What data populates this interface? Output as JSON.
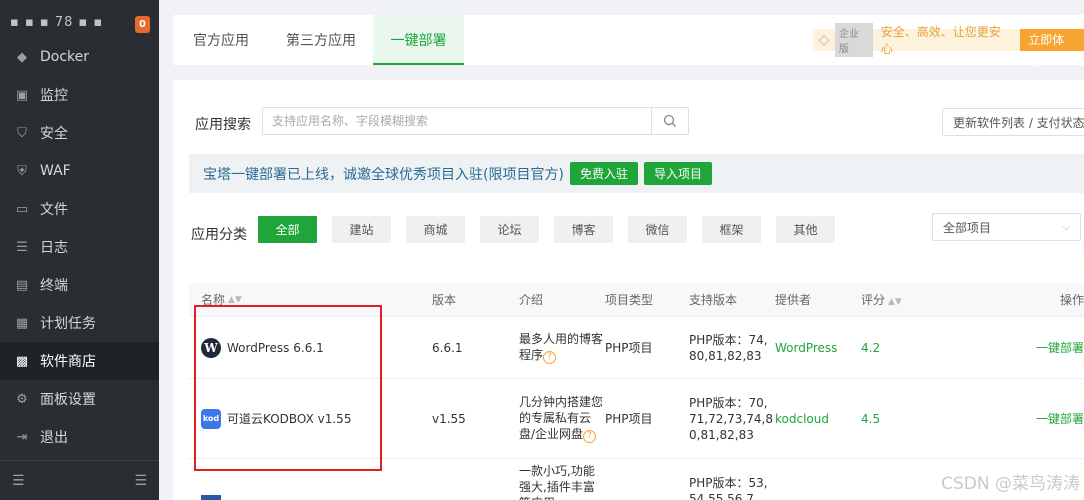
{
  "sidebar": {
    "host": "▪ ▪ ▪ 78 ▪ ▪",
    "badge": "0",
    "items": [
      {
        "label": "Docker",
        "icon": "docker-icon",
        "glyph": "◆"
      },
      {
        "label": "监控",
        "icon": "monitor-icon",
        "glyph": "▣"
      },
      {
        "label": "安全",
        "icon": "shield-icon",
        "glyph": "⛉"
      },
      {
        "label": "WAF",
        "icon": "waf-icon",
        "glyph": "⛨"
      },
      {
        "label": "文件",
        "icon": "folder-icon",
        "glyph": "▭"
      },
      {
        "label": "日志",
        "icon": "log-icon",
        "glyph": "☰"
      },
      {
        "label": "终端",
        "icon": "terminal-icon",
        "glyph": "▤"
      },
      {
        "label": "计划任务",
        "icon": "calendar-icon",
        "glyph": "▦"
      },
      {
        "label": "软件商店",
        "icon": "store-icon",
        "glyph": "▩"
      },
      {
        "label": "面板设置",
        "icon": "gear-icon",
        "glyph": "⚙"
      },
      {
        "label": "退出",
        "icon": "logout-icon",
        "glyph": "⇥"
      }
    ],
    "bottom_left": "☰",
    "bottom_right": "☰"
  },
  "tabs": [
    "官方应用",
    "第三方应用",
    "一键部署"
  ],
  "enterprise": {
    "tag": "企业版",
    "slogan": "安全、高效、让您更安心",
    "trial": "立即体验"
  },
  "search": {
    "label": "应用搜索",
    "placeholder": "支持应用名称、字段模糊搜索"
  },
  "update_button": "更新软件列表 / 支付状态",
  "notice": {
    "text": "宝塔一键部署已上线，诚邀全球优秀项目入驻(限项目官方)",
    "join": "免费入驻",
    "import": "导入项目"
  },
  "categories": {
    "label": "应用分类",
    "items": [
      "全部",
      "建站",
      "商城",
      "论坛",
      "博客",
      "微信",
      "框架",
      "其他"
    ]
  },
  "filter_select": "全部项目",
  "table": {
    "headers": [
      "名称",
      "版本",
      "介绍",
      "项目类型",
      "支持版本",
      "提供者",
      "评分",
      "操作"
    ],
    "rows": [
      {
        "name": "WordPress 6.6.1",
        "version": "6.6.1",
        "intro": "最多人用的博客程序",
        "type": "PHP项目",
        "support": "PHP版本：74,80,81,82,83",
        "provider": "WordPress",
        "score": "4.2",
        "action": "一键部署"
      },
      {
        "name": "可道云KODBOX v1.55",
        "version": "v1.55",
        "intro": "几分钟内搭建您的专属私有云盘/企业网盘",
        "type": "PHP项目",
        "support": "PHP版本：70,71,72,73,74,80,81,82,83",
        "provider": "kodcloud",
        "score": "4.5",
        "action": "一键部署"
      },
      {
        "name": "",
        "version": "",
        "intro": "一款小巧,功能强大,插件丰富等应用",
        "type": "",
        "support": "PHP版本：53,54,55,56,7",
        "provider": "",
        "score": "",
        "action": ""
      }
    ]
  },
  "watermark": "CSDN @菜鸟涛涛",
  "colors": {
    "accent": "#20a53a",
    "sidebar_bg": "#2a2e33",
    "highlight": "#e02020",
    "trial": "#f7a430"
  }
}
